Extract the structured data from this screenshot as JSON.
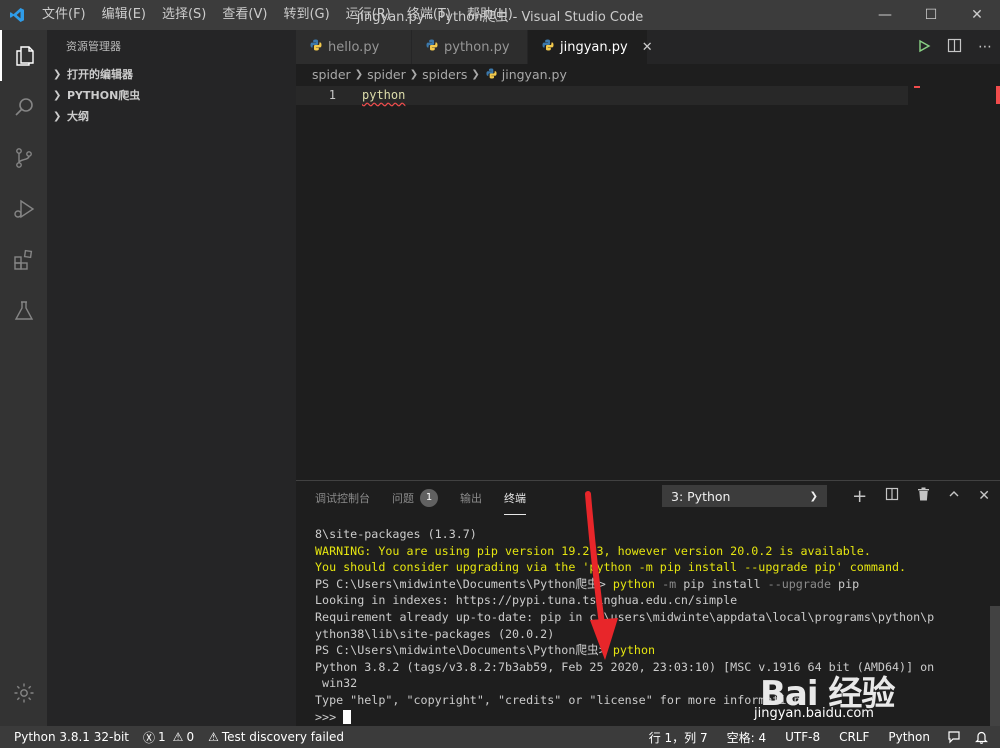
{
  "titlebar": {
    "menu": [
      "文件(F)",
      "编辑(E)",
      "选择(S)",
      "查看(V)",
      "转到(G)",
      "运行(R)",
      "终端(T)",
      "帮助(H)"
    ],
    "window_title": "jingyan.py - Python爬虫 - Visual Studio Code",
    "min_icon": "minimize-icon",
    "max_icon": "maximize-icon",
    "close_icon": "close-icon"
  },
  "activity_bar": {
    "items": [
      "explorer-icon",
      "search-icon",
      "source-control-icon",
      "run-debug-icon",
      "extensions-icon",
      "testing-icon"
    ],
    "bottom": "gear-icon"
  },
  "sidebar": {
    "title": "资源管理器",
    "sections": [
      "打开的编辑器",
      "PYTHON爬虫",
      "大纲"
    ]
  },
  "editor": {
    "tabs": [
      {
        "label": "hello.py",
        "active": false
      },
      {
        "label": "python.py",
        "active": false
      },
      {
        "label": "jingyan.py",
        "active": true
      }
    ],
    "breadcrumb": [
      "spider",
      "spider",
      "spiders",
      "jingyan.py"
    ],
    "line_number": "1",
    "code": "python"
  },
  "panel": {
    "tabs": [
      {
        "label": "调试控制台",
        "active": false
      },
      {
        "label": "问题",
        "badge": "1",
        "active": false
      },
      {
        "label": "输出",
        "active": false
      },
      {
        "label": "终端",
        "active": true
      }
    ],
    "terminal_select": "3: Python",
    "terminal_lines": [
      [
        {
          "t": "8\\site-packages (1.3.7)",
          "c": "w"
        }
      ],
      [
        {
          "t": "WARNING: You are using pip version 19.2.3, however version 20.0.2 is available.",
          "c": "y"
        }
      ],
      [
        {
          "t": "You should consider upgrading via the 'python -m pip install --upgrade pip' command.",
          "c": "y"
        }
      ],
      [
        {
          "t": "PS C:\\Users\\midwinte\\Documents\\Python爬虫> ",
          "c": "w"
        },
        {
          "t": "python",
          "c": "y"
        },
        {
          "t": " -m ",
          "c": "g"
        },
        {
          "t": "pip install ",
          "c": "w"
        },
        {
          "t": "--upgrade ",
          "c": "g"
        },
        {
          "t": "pip",
          "c": "w"
        }
      ],
      [
        {
          "t": "Looking in indexes: https://pypi.tuna.tsinghua.edu.cn/simple",
          "c": "w"
        }
      ],
      [
        {
          "t": "Requirement already up-to-date: pip in c:\\users\\midwinte\\appdata\\local\\programs\\python\\p",
          "c": "w"
        }
      ],
      [
        {
          "t": "ython38\\lib\\site-packages (20.0.2)",
          "c": "w"
        }
      ],
      [
        {
          "t": "PS C:\\Users\\midwinte\\Documents\\Python爬虫> ",
          "c": "w"
        },
        {
          "t": "python",
          "c": "y"
        }
      ],
      [
        {
          "t": "Python 3.8.2 (tags/v3.8.2:7b3ab59, Feb 25 2020, 23:03:10) [MSC v.1916 64 bit (AMD64)] on",
          "c": "w"
        }
      ],
      [
        {
          "t": " win32",
          "c": "w"
        }
      ],
      [
        {
          "t": "Type \"help\", \"copyright\", \"credits\" or \"license\" for more information.",
          "c": "w"
        }
      ],
      [
        {
          "t": ">>> ",
          "c": "w"
        }
      ]
    ]
  },
  "statusbar": {
    "interpreter": "Python 3.8.1 32-bit",
    "errors": "1",
    "warnings": "0",
    "test_status": "Test discovery failed",
    "position": "行 1，列 7",
    "spaces": "空格: 4",
    "encoding": "UTF-8",
    "eol": "CRLF",
    "language": "Python"
  },
  "watermark": {
    "brand": "Bai  经验",
    "url": "jingyan.baidu.com"
  },
  "colors": {
    "accent_arrow": "#e8262a",
    "terminal_yellow": "#e5e510",
    "vscode_blue": "#0078d4"
  }
}
